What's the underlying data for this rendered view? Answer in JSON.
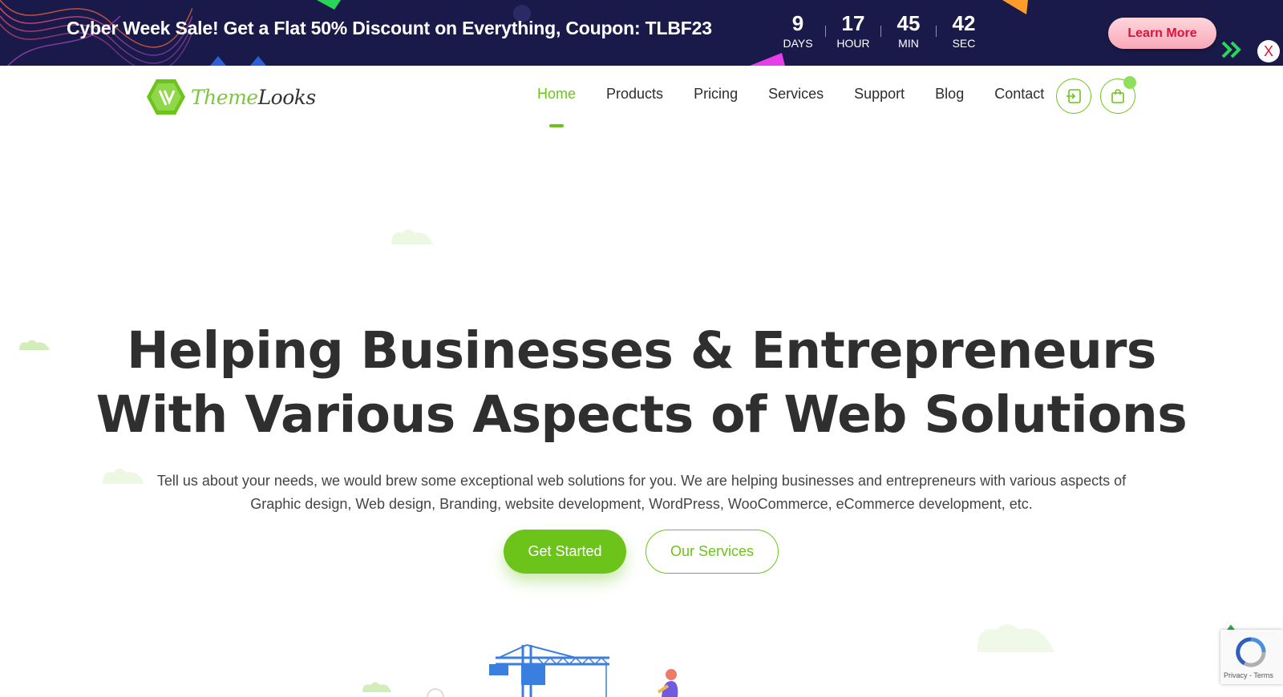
{
  "promo": {
    "text": "Cyber Week Sale! Get a Flat 50% Discount on Everything, Coupon: TLBF23",
    "countdown": [
      {
        "value": "9",
        "label": "DAYS"
      },
      {
        "value": "17",
        "label": "HOUR"
      },
      {
        "value": "45",
        "label": "MIN"
      },
      {
        "value": "42",
        "label": "SEC"
      }
    ],
    "cta_label": "Learn More",
    "close_label": "X",
    "icons": [
      "double-chevron-right-icon",
      "close-icon"
    ]
  },
  "header": {
    "logo": {
      "part1": "Theme",
      "part2": "Looks",
      "icon": "hexagon-logo-icon"
    },
    "nav": [
      {
        "label": "Home",
        "active": true
      },
      {
        "label": "Products",
        "active": false
      },
      {
        "label": "Pricing",
        "active": false
      },
      {
        "label": "Services",
        "active": false
      },
      {
        "label": "Support",
        "active": false
      },
      {
        "label": "Blog",
        "active": false
      },
      {
        "label": "Contact",
        "active": false
      }
    ],
    "icons": [
      "login-icon",
      "shopping-bag-icon"
    ]
  },
  "hero": {
    "title_line1": "Helping Businesses & Entrepreneurs",
    "title_line2": "With Various Aspects of Web Solutions",
    "subtitle_line1": "Tell us about your needs, we would brew some exceptional web solutions for you. We are helping businesses and entrepreneurs with various aspects of",
    "subtitle_line2": "Graphic design, Web design, Branding, website development, WordPress, WooCommerce, eCommerce development, etc.",
    "primary_cta": "Get Started",
    "secondary_cta": "Our Services"
  },
  "widgets": {
    "recaptcha_text": "Privacy - Terms",
    "icons": [
      "arrow-up-icon",
      "recaptcha-icon"
    ]
  },
  "colors": {
    "brand_green": "#6cc41b",
    "banner_bg": "#1a1a4a",
    "cta_red": "#e0123a",
    "heading": "#2f2f2f"
  }
}
